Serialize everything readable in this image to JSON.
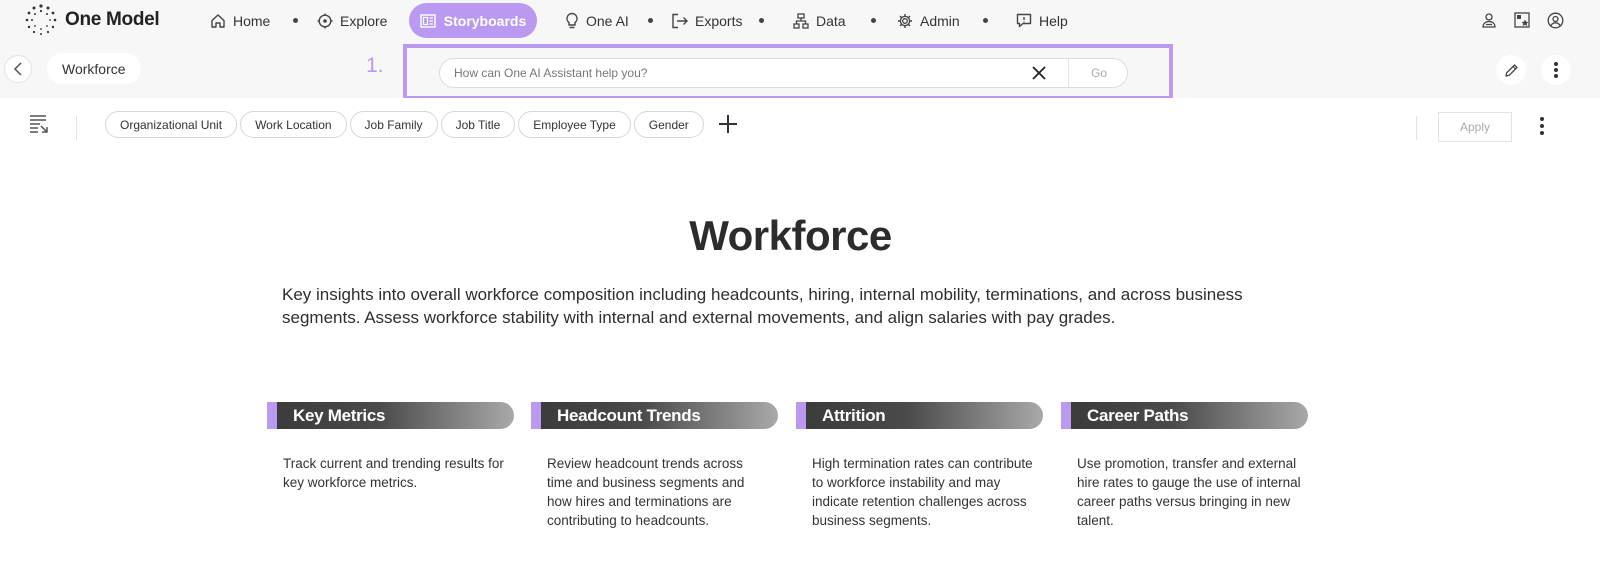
{
  "app": {
    "logo_text": "One Model"
  },
  "nav": {
    "items": [
      {
        "label": "Home",
        "icon": "home-icon"
      },
      {
        "label": "Explore",
        "icon": "compass-icon"
      },
      {
        "label": "Storyboards",
        "icon": "storyboard-icon",
        "active": true
      },
      {
        "label": "One AI",
        "icon": "lightbulb-icon"
      },
      {
        "label": "Exports",
        "icon": "export-icon"
      },
      {
        "label": "Data",
        "icon": "data-icon"
      },
      {
        "label": "Admin",
        "icon": "gear-icon"
      },
      {
        "label": "Help",
        "icon": "help-icon"
      }
    ],
    "right_icons": [
      "user-switch-icon",
      "favorites-icon",
      "profile-icon"
    ]
  },
  "subbar": {
    "breadcrumb": "Workforce",
    "step_marker": "1.",
    "ai_search": {
      "placeholder": "How can One AI Assistant help you?",
      "value": "",
      "go_label": "Go"
    }
  },
  "filters": {
    "chips": [
      "Organizational Unit",
      "Work Location",
      "Job Family",
      "Job Title",
      "Employee Type",
      "Gender"
    ],
    "apply_label": "Apply"
  },
  "page": {
    "title": "Workforce",
    "intro": "Key insights into overall workforce composition including headcounts, hiring, internal mobility, terminations, and across business segments.  Assess workforce stability with internal and external movements, and align salaries with pay grades.",
    "cards": [
      {
        "title": "Key Metrics",
        "body": "Track current and trending results for key workforce metrics."
      },
      {
        "title": "Headcount Trends",
        "body": "Review headcount trends across time and business segments and how hires and terminations are contributing to headcounts."
      },
      {
        "title": "Attrition",
        "body": "High termination rates can contribute to workforce instability and may indicate retention challenges across business segments."
      },
      {
        "title": "Career Paths",
        "body": "Use promotion, transfer and external hire rates to gauge the use of internal career paths versus bringing in new talent."
      }
    ]
  },
  "colors": {
    "accent": "#b99af0",
    "bar_bg": "#f7f7f8",
    "card_head_dark": "#3a3a3a"
  }
}
